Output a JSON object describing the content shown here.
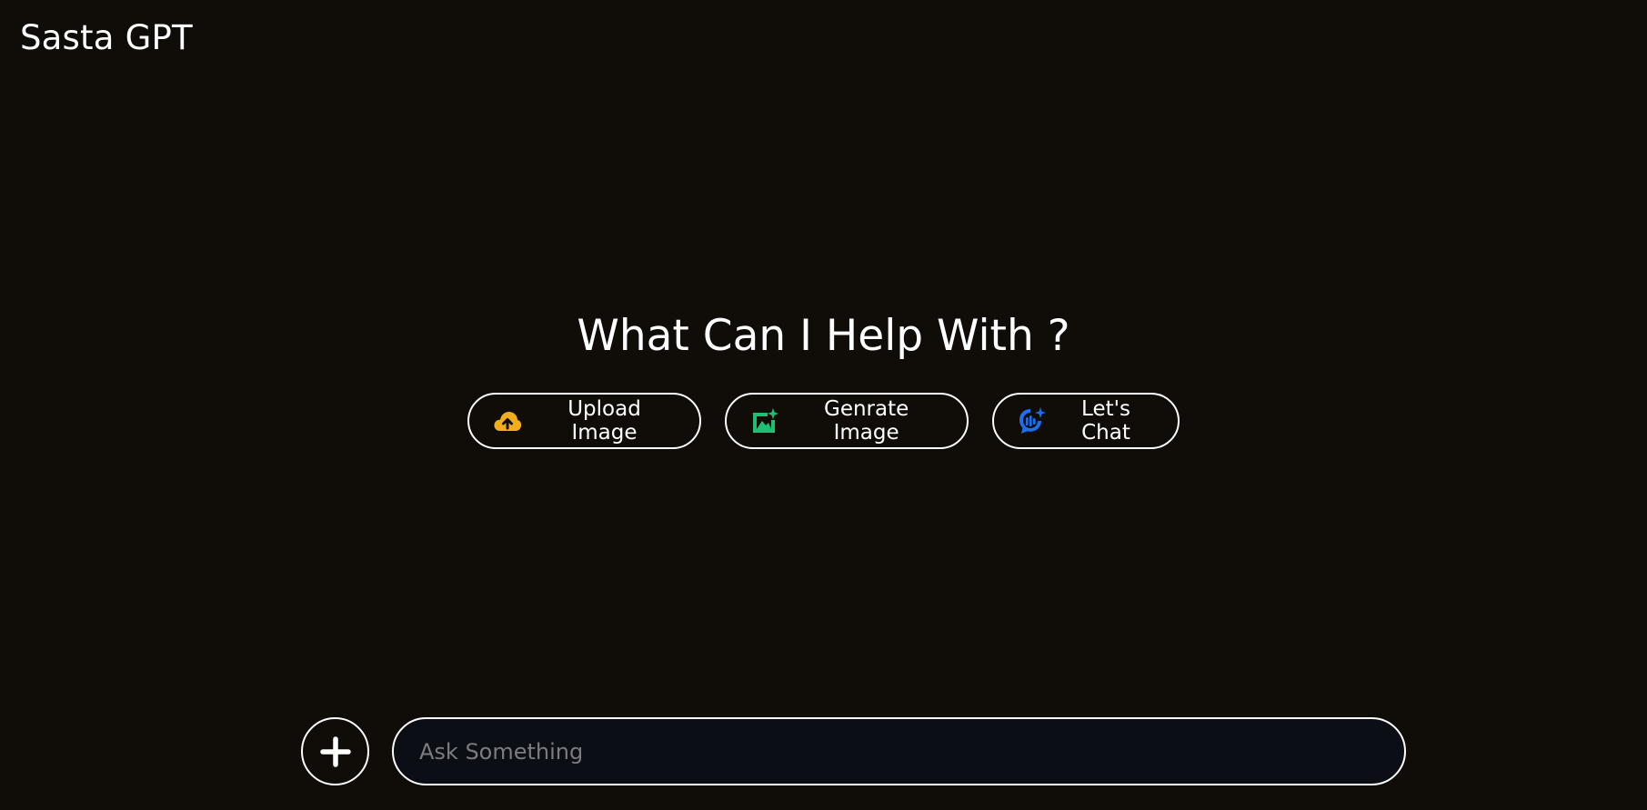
{
  "app": {
    "brand": "Sasta GPT"
  },
  "hero": {
    "title": "What Can I Help With ?"
  },
  "actions": [
    {
      "label": "Upload Image",
      "icon": "cloud-upload-icon",
      "color": "#f0ad1c"
    },
    {
      "label": "Genrate Image",
      "icon": "image-sparkle-icon",
      "color": "#1dbf73"
    },
    {
      "label": "Let's Chat",
      "icon": "chat-sparkle-icon",
      "color": "#1e6ff0"
    }
  ],
  "composer": {
    "plus_icon": "plus-icon",
    "placeholder": "Ask Something",
    "value": ""
  },
  "colors": {
    "background": "#100d09",
    "input_background": "#0b0e15",
    "border": "#ffffff",
    "placeholder": "#7b7b80"
  }
}
